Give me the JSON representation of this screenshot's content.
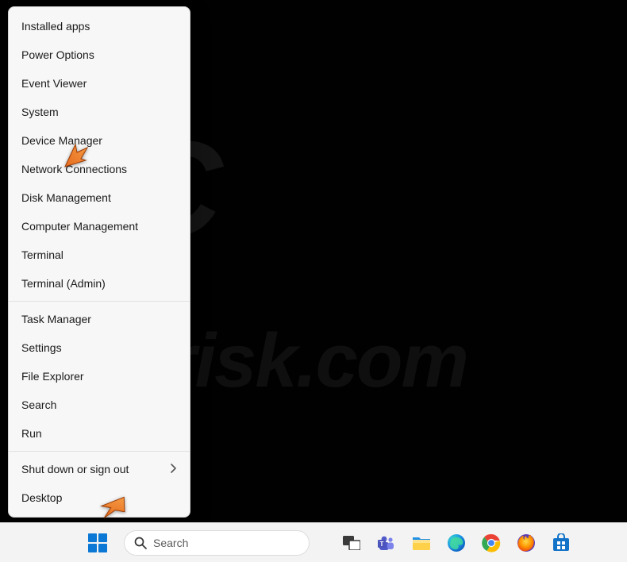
{
  "watermark": {
    "main": "PC",
    "sub": "risk.com"
  },
  "winx": {
    "groups": [
      {
        "items": [
          {
            "label": "Installed apps",
            "submenu": false
          },
          {
            "label": "Power Options",
            "submenu": false
          },
          {
            "label": "Event Viewer",
            "submenu": false
          },
          {
            "label": "System",
            "submenu": false
          },
          {
            "label": "Device Manager",
            "submenu": false
          },
          {
            "label": "Network Connections",
            "submenu": false
          },
          {
            "label": "Disk Management",
            "submenu": false
          },
          {
            "label": "Computer Management",
            "submenu": false
          },
          {
            "label": "Terminal",
            "submenu": false
          },
          {
            "label": "Terminal (Admin)",
            "submenu": false
          }
        ]
      },
      {
        "items": [
          {
            "label": "Task Manager",
            "submenu": false
          },
          {
            "label": "Settings",
            "submenu": false
          },
          {
            "label": "File Explorer",
            "submenu": false
          },
          {
            "label": "Search",
            "submenu": false
          },
          {
            "label": "Run",
            "submenu": false
          }
        ]
      },
      {
        "items": [
          {
            "label": "Shut down or sign out",
            "submenu": true
          },
          {
            "label": "Desktop",
            "submenu": false
          }
        ]
      }
    ]
  },
  "taskbar": {
    "search_placeholder": "Search",
    "icons": {
      "start": "start-icon",
      "task_view": "task-view-icon",
      "teams": "teams-icon",
      "explorer": "file-explorer-icon",
      "edge": "edge-icon",
      "chrome": "chrome-icon",
      "firefox": "firefox-icon",
      "store": "store-icon"
    }
  },
  "annotations": {
    "arrow1_target": "Device Manager",
    "arrow2_target": "Start button"
  }
}
